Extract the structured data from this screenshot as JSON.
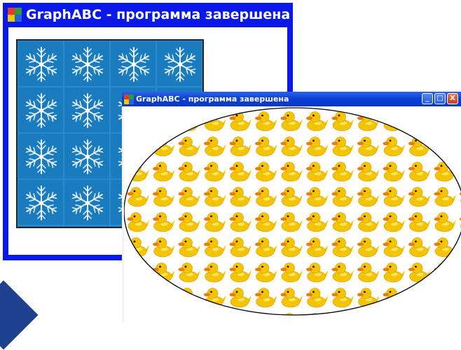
{
  "colors": {
    "back_window_frame": "#0a18e8",
    "front_titlebar": "#0a3fd4",
    "snow_background": "#1b7bbf",
    "duck_body": "#f5c400",
    "duck_beak": "#f07a00"
  },
  "back_window": {
    "title": "GraphABC - программа завершена",
    "icon": "graphabc-app-icon",
    "fill_pattern": "snowflake-tiles"
  },
  "front_window": {
    "title": "GraphABC - программа завершена",
    "icon": "graphabc-app-icon",
    "controls": {
      "minimize": "_",
      "maximize": "□",
      "close": "X"
    },
    "fill_pattern": "rubber-duck-tiles",
    "shape": "ellipse"
  }
}
